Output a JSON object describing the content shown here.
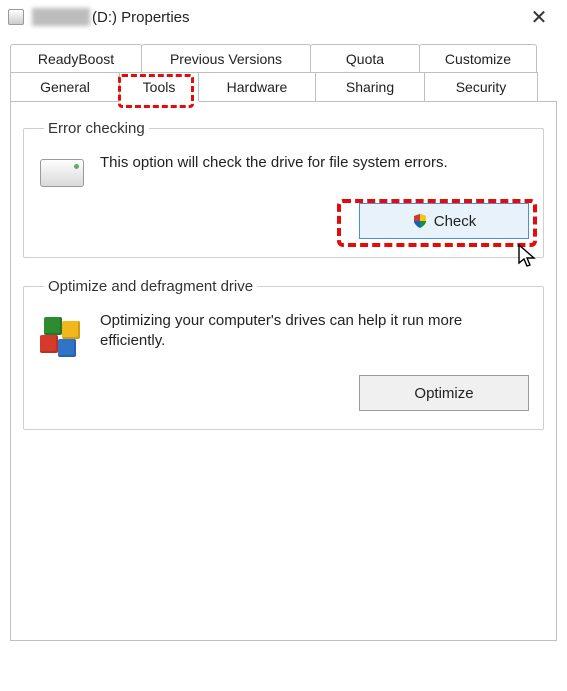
{
  "window": {
    "title_suffix": "(D:) Properties"
  },
  "tabs": {
    "row1": [
      "ReadyBoost",
      "Previous Versions",
      "Quota",
      "Customize"
    ],
    "row2": [
      "General",
      "Tools",
      "Hardware",
      "Sharing",
      "Security"
    ],
    "active": "Tools"
  },
  "groups": {
    "error_checking": {
      "legend": "Error checking",
      "desc": "This option will check the drive for file system errors.",
      "button": "Check"
    },
    "optimize": {
      "legend": "Optimize and defragment drive",
      "desc": "Optimizing your computer's drives can help it run more efficiently.",
      "button": "Optimize"
    }
  }
}
